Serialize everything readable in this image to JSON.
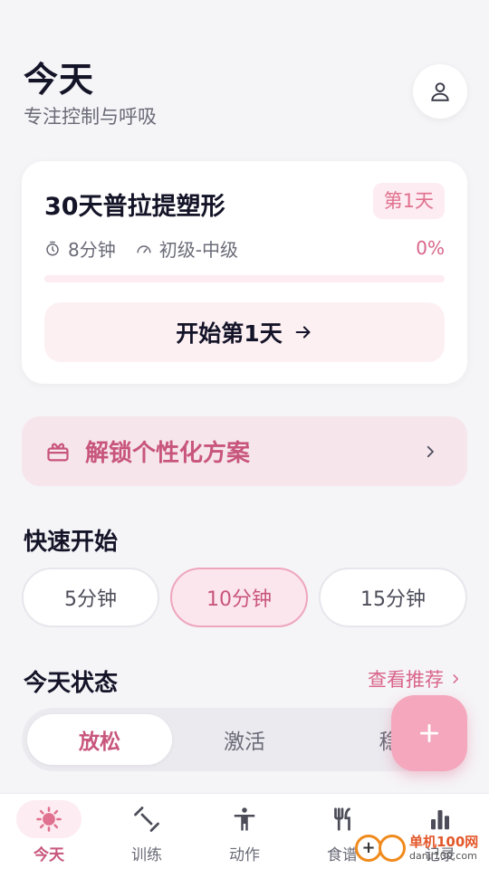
{
  "header": {
    "title": "今天",
    "subtitle": "专注控制与呼吸"
  },
  "plan": {
    "title": "30天普拉提塑形",
    "day_badge": "第1天",
    "duration": "8分钟",
    "level": "初级-中级",
    "progress_text": "0%",
    "progress_fraction": 0,
    "start_label": "开始第1天"
  },
  "unlock": {
    "label": "解锁个性化方案"
  },
  "quick_start": {
    "title": "快速开始",
    "options": [
      "5分钟",
      "10分钟",
      "15分钟"
    ],
    "selected": "10分钟"
  },
  "status": {
    "title": "今天状态",
    "see_more": "查看推荐",
    "segments": [
      "放松",
      "激活",
      "稳"
    ],
    "selected": "放松"
  },
  "tabbar": {
    "items": [
      "今天",
      "训练",
      "动作",
      "食谱",
      "记录"
    ],
    "active": "今天"
  },
  "watermark": {
    "name": "单机100网",
    "url": "danji100.com"
  },
  "colors": {
    "accent": "#c8557c",
    "accent_light": "#fdecf1",
    "fab": "#f4a7bd",
    "background": "#f5f4f7"
  }
}
